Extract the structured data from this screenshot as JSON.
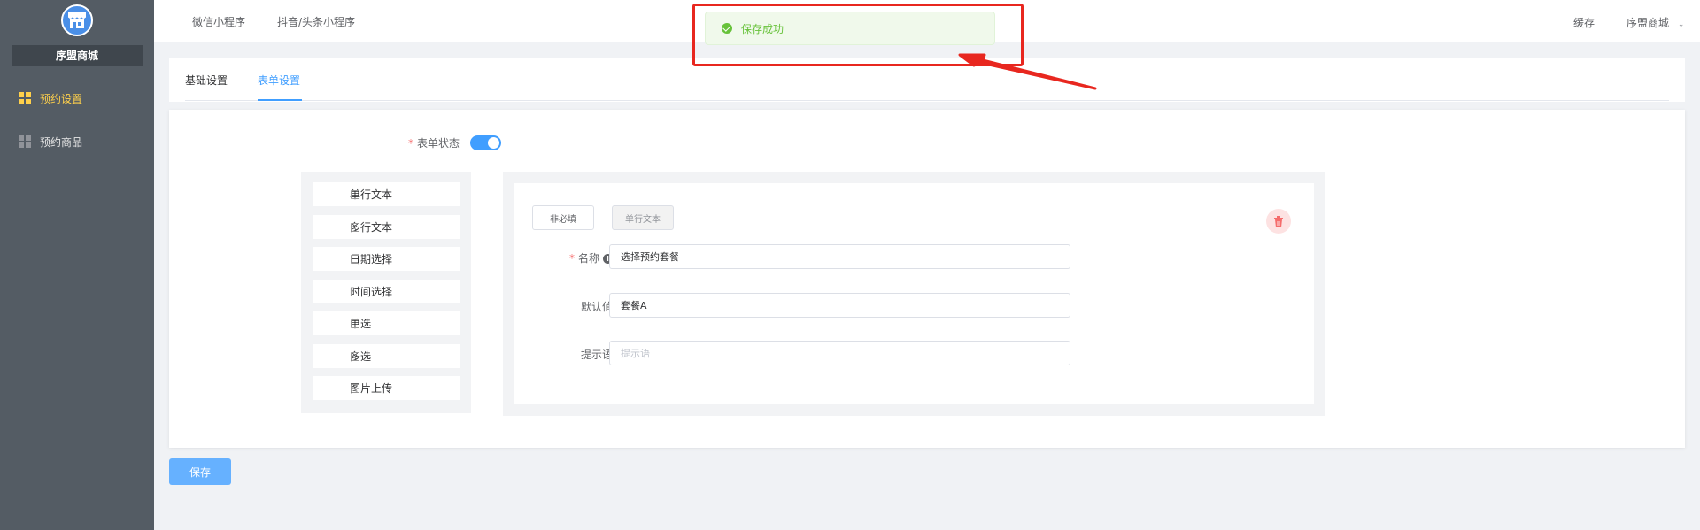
{
  "sidebar": {
    "shop_name": "序盟商城",
    "items": [
      {
        "label": "预约设置",
        "icon": "grid-icon",
        "active": true
      },
      {
        "label": "预约商品",
        "icon": "grid-icon",
        "active": false
      }
    ]
  },
  "topbar": {
    "links": [
      "微信小程序",
      "抖音/头条小程序"
    ],
    "cache_label": "缓存",
    "user_label": "序盟商城"
  },
  "toast": {
    "message": "保存成功",
    "icon": "success-check-icon",
    "color": "#67c23a"
  },
  "tabs": [
    {
      "label": "基础设置",
      "active": false
    },
    {
      "label": "表单设置",
      "active": true
    }
  ],
  "form": {
    "status_label": "表单状态",
    "status_on": true,
    "settings_label": "表单设置",
    "palette": [
      "单行文本",
      "多行文本",
      "日期选择",
      "时间选择",
      "单选",
      "多选",
      "图片上传"
    ],
    "editor": {
      "required_toggle_label": "非必填",
      "field_type_label": "单行文本",
      "name_label": "名称",
      "name_value": "选择预约套餐",
      "default_label": "默认值",
      "default_value": "套餐A",
      "hint_label": "提示语",
      "hint_placeholder": "提示语"
    }
  },
  "save_label": "保存",
  "colors": {
    "accent": "#409eff",
    "sidebar": "#545c64",
    "active_menu": "#ffd04b",
    "danger": "#f56c6c",
    "annotation": "#e8271f"
  }
}
